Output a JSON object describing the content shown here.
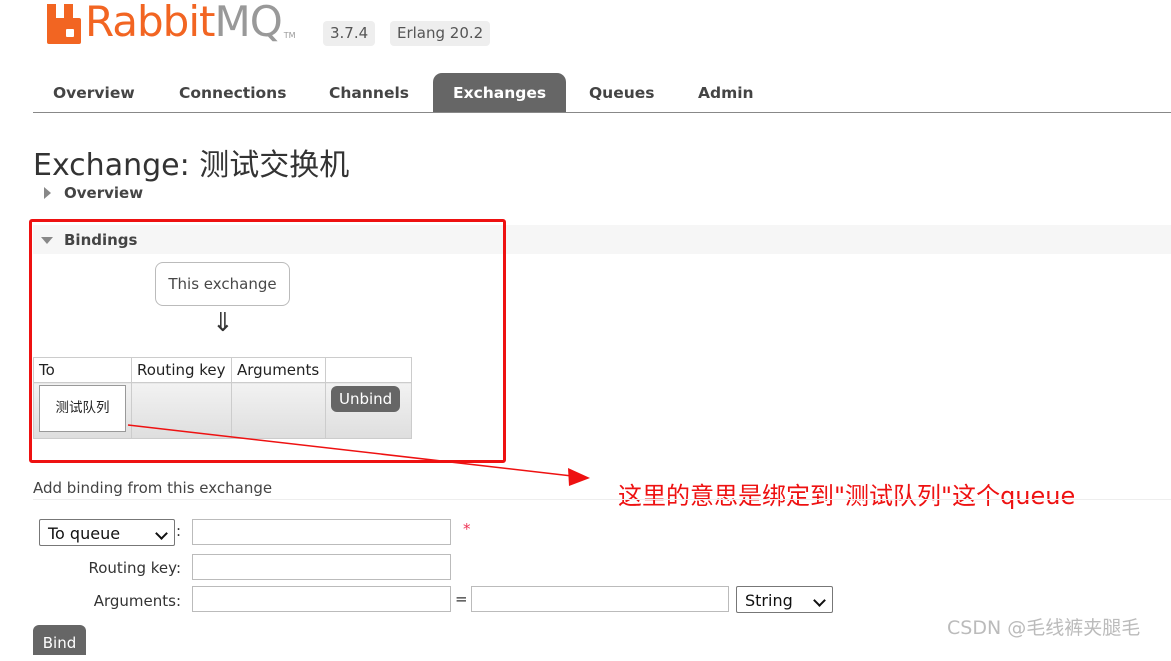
{
  "header": {
    "logo_text_a": "Rabbit",
    "logo_text_b": "MQ",
    "logo_tm": "TM",
    "version": "3.7.4",
    "erlang": "Erlang 20.2"
  },
  "nav": {
    "tabs": [
      {
        "label": "Overview",
        "active": false
      },
      {
        "label": "Connections",
        "active": false
      },
      {
        "label": "Channels",
        "active": false
      },
      {
        "label": "Exchanges",
        "active": true
      },
      {
        "label": "Queues",
        "active": false
      },
      {
        "label": "Admin",
        "active": false
      }
    ]
  },
  "page": {
    "title": "Exchange: 测试交换机",
    "overview_section": "Overview",
    "bindings_section": "Bindings"
  },
  "bindings": {
    "this_exchange": "This exchange",
    "arrow": "⇓",
    "columns": [
      "To",
      "Routing key",
      "Arguments",
      ""
    ],
    "rows": [
      {
        "to": "测试队列",
        "routing_key": "",
        "arguments": "",
        "action": "Unbind"
      }
    ]
  },
  "annotation": {
    "text": "这里的意思是绑定到\"测试队列\"这个queue",
    "color": "#ee1111"
  },
  "add_binding": {
    "heading": "Add binding from this exchange",
    "destination_type": "To queue",
    "destination_value": "",
    "required_mark": "*",
    "routing_key_label": "Routing key:",
    "routing_key_value": "",
    "arguments_label": "Arguments:",
    "arg_key": "",
    "equals": "=",
    "arg_value": "",
    "arg_type": "String",
    "bind_button": "Bind",
    "colon": ":"
  },
  "watermark": "CSDN @毛线裤夹腿毛"
}
